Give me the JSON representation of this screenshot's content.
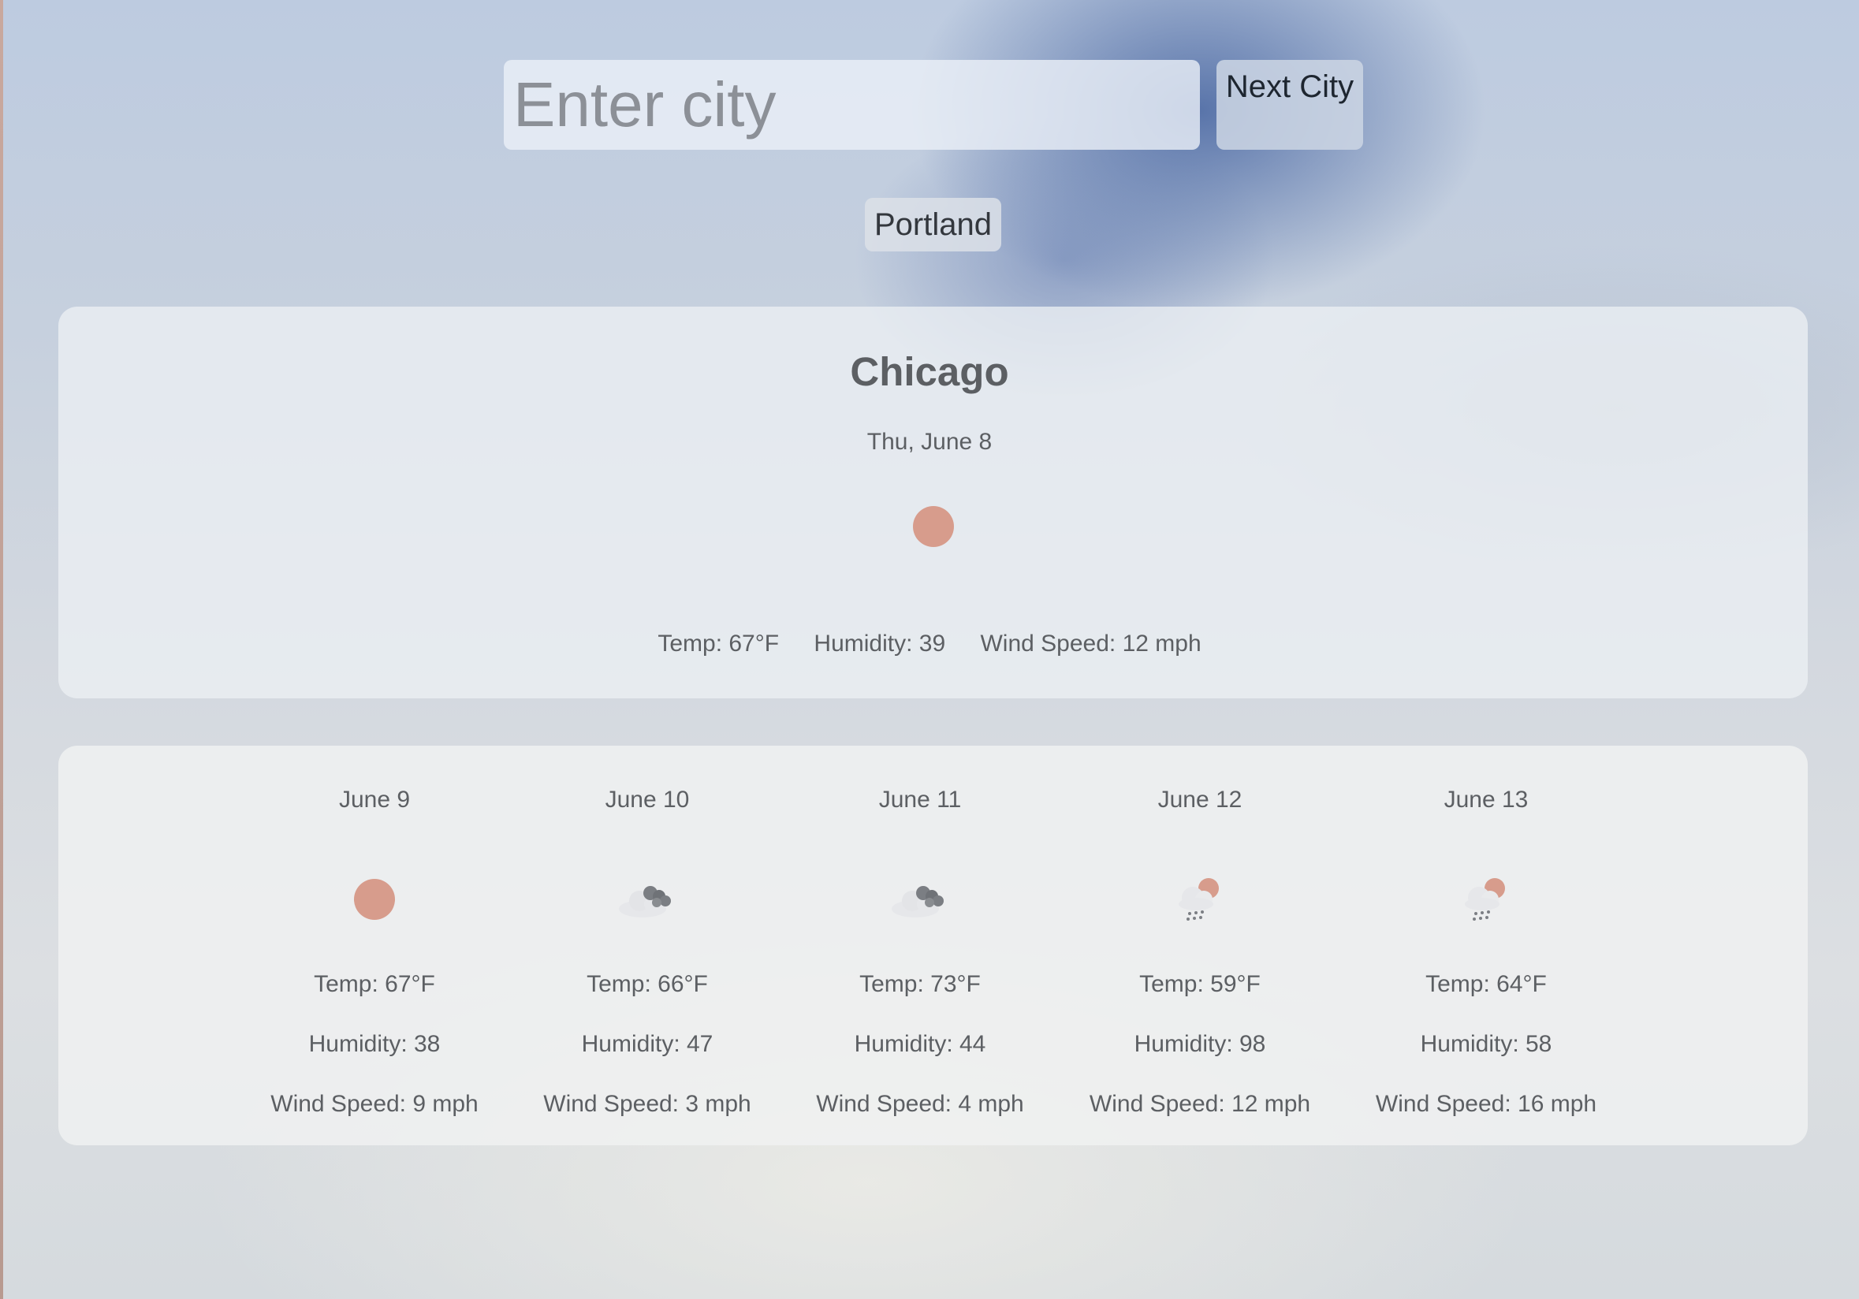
{
  "search": {
    "placeholder": "Enter city",
    "value": "",
    "next_label": "Next City"
  },
  "history": [
    "Portland"
  ],
  "current": {
    "city": "Chicago",
    "date": "Thu, June 8",
    "icon": "sun-icon",
    "temp": "Temp: 67°F",
    "humidity": "Humidity: 39",
    "wind": "Wind Speed: 12 mph"
  },
  "forecast": [
    {
      "date": "June 9",
      "icon": "sun-icon",
      "temp": "Temp: 67°F",
      "humidity": "Humidity: 38",
      "wind": "Wind Speed: 9 mph"
    },
    {
      "date": "June 10",
      "icon": "cloud-icon",
      "temp": "Temp: 66°F",
      "humidity": "Humidity: 47",
      "wind": "Wind Speed: 3 mph"
    },
    {
      "date": "June 11",
      "icon": "cloud-icon",
      "temp": "Temp: 73°F",
      "humidity": "Humidity: 44",
      "wind": "Wind Speed: 4 mph"
    },
    {
      "date": "June 12",
      "icon": "sun-rain-icon",
      "temp": "Temp: 59°F",
      "humidity": "Humidity: 98",
      "wind": "Wind Speed: 12 mph"
    },
    {
      "date": "June 13",
      "icon": "sun-rain-icon",
      "temp": "Temp: 64°F",
      "humidity": "Humidity: 58",
      "wind": "Wind Speed: 16 mph"
    }
  ],
  "colors": {
    "sun": "#d79c8c",
    "text": "#5c5f63",
    "card": "#eceff4"
  }
}
